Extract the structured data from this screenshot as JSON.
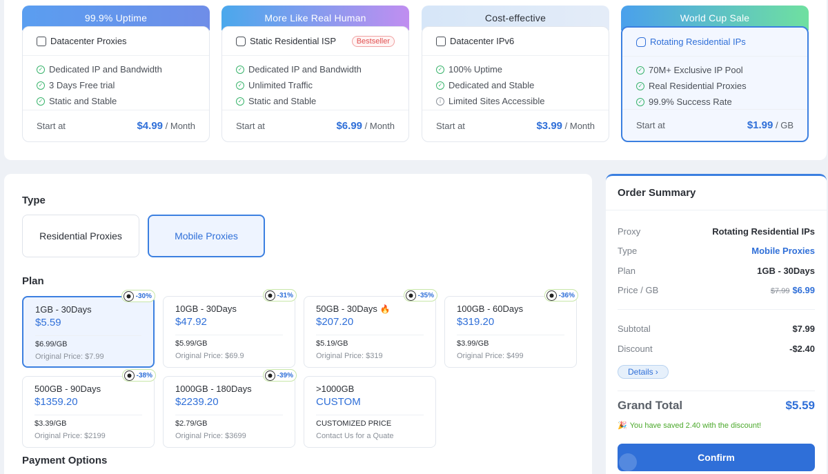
{
  "products": [
    {
      "banner": "99.9% Uptime",
      "banner_colors": [
        "#5a9ef0",
        "#6f8de8"
      ],
      "name": "Datacenter Proxies",
      "icon": "server-icon",
      "features": [
        {
          "text": "Dedicated IP and Bandwidth",
          "icon": "check-icon"
        },
        {
          "text": "3 Days Free trial",
          "icon": "check-icon"
        },
        {
          "text": "Static and Stable",
          "icon": "check-icon"
        }
      ],
      "start_label": "Start at",
      "price": "$4.99",
      "unit": "/ Month"
    },
    {
      "banner": "More Like Real Human",
      "banner_colors": [
        "#4aa8ec",
        "#c08ef0"
      ],
      "name": "Static Residential ISP",
      "icon": "device-icon",
      "badge": "Bestseller",
      "features": [
        {
          "text": "Dedicated IP and Bandwidth",
          "icon": "check-icon"
        },
        {
          "text": "Unlimited Traffic",
          "icon": "check-icon"
        },
        {
          "text": "Static and Stable",
          "icon": "check-icon"
        }
      ],
      "start_label": "Start at",
      "price": "$6.99",
      "unit": "/ Month"
    },
    {
      "banner": "Cost-effective",
      "banner_colors": [
        "#d6e6f8",
        "#e4ecf8"
      ],
      "name": "Datacenter IPv6",
      "icon": "chart-icon",
      "features": [
        {
          "text": "100% Uptime",
          "icon": "check-icon"
        },
        {
          "text": "Dedicated and Stable",
          "icon": "check-icon"
        },
        {
          "text": "Limited Sites Accessible",
          "icon": "info-icon"
        }
      ],
      "start_label": "Start at",
      "price": "$3.99",
      "unit": "/ Month"
    },
    {
      "banner": "World Cup Sale",
      "banner_colors": [
        "#4aa0ec",
        "#6fe0a0"
      ],
      "name": "Rotating Residential IPs",
      "icon": "rotate-icon",
      "features": [
        {
          "text": "70M+ Exclusive IP Pool",
          "icon": "check-icon"
        },
        {
          "text": "Real Residential Proxies",
          "icon": "check-icon"
        },
        {
          "text": "99.9% Success Rate",
          "icon": "check-icon"
        }
      ],
      "start_label": "Start at",
      "price": "$1.99",
      "unit": "/ GB"
    }
  ],
  "config": {
    "type_title": "Type",
    "types": [
      "Residential Proxies",
      "Mobile Proxies"
    ],
    "plan_title": "Plan",
    "payment_title": "Payment Options",
    "plans": [
      {
        "name": "1GB - 30Days",
        "price": "$5.59",
        "per_gb": "$6.99/GB",
        "orig": "Original Price: $7.99",
        "discount": "-30%"
      },
      {
        "name": "10GB - 30Days",
        "price": "$47.92",
        "per_gb": "$5.99/GB",
        "orig": "Original Price: $69.9",
        "discount": "-31%"
      },
      {
        "name": "50GB - 30Days",
        "price": "$207.20",
        "per_gb": "$5.19/GB",
        "orig": "Original Price: $319",
        "discount": "-35%"
      },
      {
        "name": "100GB - 60Days",
        "price": "$319.20",
        "per_gb": "$3.99/GB",
        "orig": "Original Price: $499",
        "discount": "-36%"
      },
      {
        "name": "500GB - 90Days",
        "price": "$1359.20",
        "per_gb": "$3.39/GB",
        "orig": "Original Price: $2199",
        "discount": "-38%"
      },
      {
        "name": "1000GB - 180Days",
        "price": "$2239.20",
        "per_gb": "$2.79/GB",
        "orig": "Original Price: $3699",
        "discount": "-39%"
      },
      {
        "name": ">1000GB",
        "price": "CUSTOM",
        "per_gb": "CUSTOMIZED PRICE",
        "orig": "Contact Us for a Quate"
      }
    ]
  },
  "summary": {
    "title": "Order Summary",
    "proxy_label": "Proxy",
    "proxy_value": "Rotating Residential IPs",
    "type_label": "Type",
    "type_value": "Mobile Proxies",
    "plan_label": "Plan",
    "plan_value": "1GB - 30Days",
    "price_label": "Price / GB",
    "price_old": "$7.99",
    "price_new": "$6.99",
    "subtotal_label": "Subtotal",
    "subtotal_value": "$7.99",
    "discount_label": "Discount",
    "discount_value": "-$2.40",
    "details_label": "Details",
    "grand_label": "Grand Total",
    "grand_value": "$5.59",
    "saved_text": "You have saved 2.40 with the discount!",
    "confirm_label": "Confirm"
  },
  "colors": {
    "accent": "#2f6fd8",
    "success": "#38b36b",
    "danger": "#e05050"
  }
}
